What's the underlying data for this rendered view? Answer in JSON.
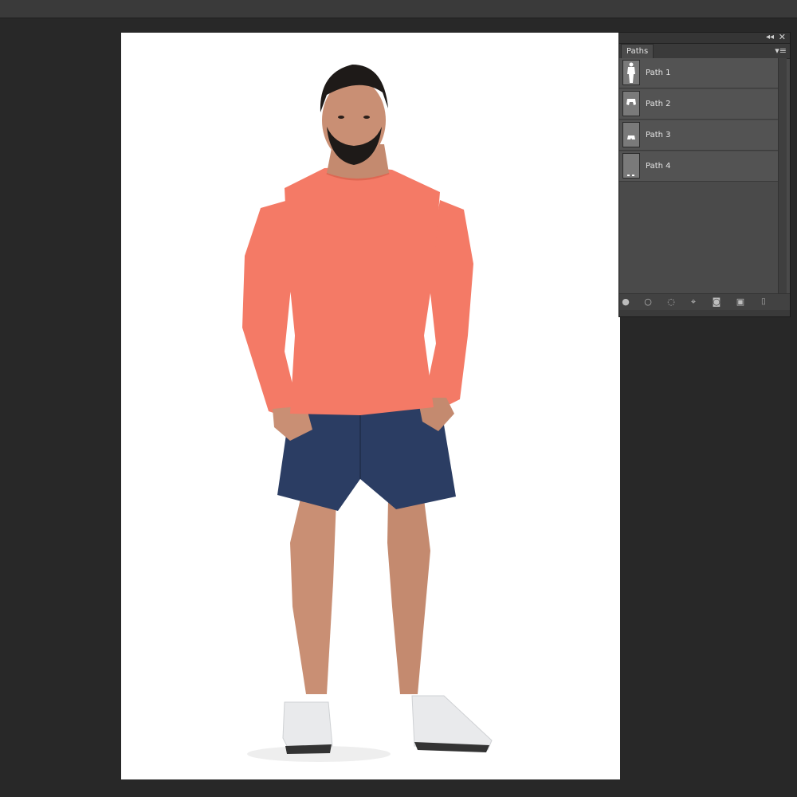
{
  "panel": {
    "tab_label": "Paths",
    "collapse_icon": "double-chevron-left-icon",
    "close_icon": "close-icon",
    "menu_icon": "panel-menu-icon",
    "paths": [
      {
        "label": "Path 1",
        "thumb": "full-figure"
      },
      {
        "label": "Path 2",
        "thumb": "torso"
      },
      {
        "label": "Path 3",
        "thumb": "shorts"
      },
      {
        "label": "Path 4",
        "thumb": "shoes"
      }
    ],
    "footer_buttons": [
      "fill-path-icon",
      "stroke-path-icon",
      "load-selection-icon",
      "make-work-path-icon",
      "add-mask-icon",
      "new-path-icon",
      "delete-path-icon"
    ]
  },
  "colors": {
    "app_background": "#282828",
    "panel_background": "#4a4a4a",
    "shirt": "#f47a66",
    "shorts": "#2b3d63"
  }
}
